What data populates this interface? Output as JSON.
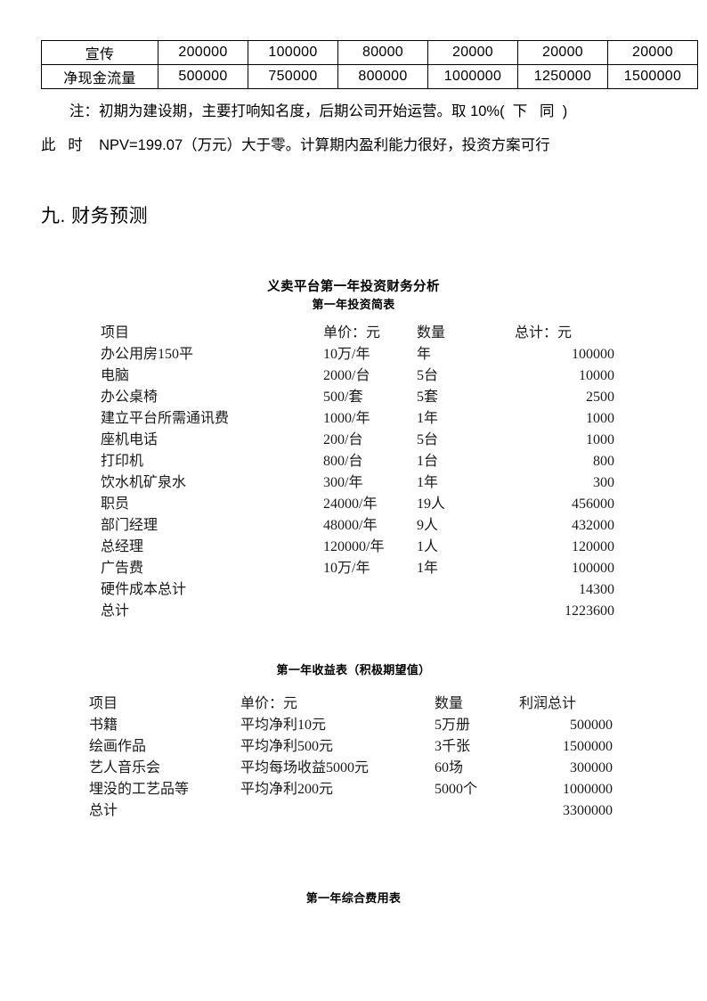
{
  "cashflow_table": {
    "rows": [
      {
        "label": "宣传",
        "values": [
          "200000",
          "100000",
          "80000",
          "20000",
          "20000",
          "20000"
        ]
      },
      {
        "label": "净现金流量",
        "values": [
          "500000",
          "750000",
          "800000",
          "1000000",
          "1250000",
          "1500000"
        ]
      }
    ]
  },
  "notes": {
    "line1": "注：初期为建设期，主要打响知名度，后期公司开始运营。取 10%(  下   同  )",
    "line2": "此   时    NPV=199.07（万元）大于零。计算期内盈利能力很好，投资方案可行"
  },
  "section": {
    "heading": "九. 财务预测"
  },
  "titles": {
    "main": "义卖平台第一年投资财务分析",
    "sub_investment": "第一年投资简表",
    "sub_revenue": "第一年收益表（积极期望值）",
    "sub_expense": "第一年综合费用表"
  },
  "investment_table": {
    "headers": {
      "item": "项目",
      "price": "单价：元",
      "qty": "数量",
      "total": "总计：元"
    },
    "rows": [
      {
        "item": "办公用房150平",
        "price": "10万/年",
        "qty": "年",
        "total": "100000"
      },
      {
        "item": "电脑",
        "price": "2000/台",
        "qty": "5台",
        "total": "10000"
      },
      {
        "item": "办公桌椅",
        "price": "500/套",
        "qty": "5套",
        "total": "2500"
      },
      {
        "item": "建立平台所需通讯费",
        "price": "1000/年",
        "qty": "1年",
        "total": "1000"
      },
      {
        "item": "座机电话",
        "price": "200/台",
        "qty": "5台",
        "total": "1000"
      },
      {
        "item": "打印机",
        "price": "800/台",
        "qty": "1台",
        "total": "800"
      },
      {
        "item": "饮水机矿泉水",
        "price": "300/年",
        "qty": "1年",
        "total": "300"
      },
      {
        "item": "职员",
        "price": "24000/年",
        "qty": "19人",
        "total": "456000"
      },
      {
        "item": "部门经理",
        "price": "48000/年",
        "qty": "9人",
        "total": "432000"
      },
      {
        "item": "总经理",
        "price": "120000/年",
        "qty": "1人",
        "total": "120000"
      },
      {
        "item": "广告费",
        "price": "10万/年",
        "qty": "1年",
        "total": "100000"
      },
      {
        "item": "硬件成本总计",
        "price": "",
        "qty": "",
        "total": "14300"
      },
      {
        "item": "总计",
        "price": "",
        "qty": "",
        "total": "1223600"
      }
    ]
  },
  "revenue_table": {
    "headers": {
      "item": "项目",
      "price": "单价：元",
      "qty": "数量",
      "total": "利润总计"
    },
    "rows": [
      {
        "item": "书籍",
        "price": "平均净利10元",
        "qty": "5万册",
        "total": "500000"
      },
      {
        "item": "绘画作品",
        "price": "平均净利500元",
        "qty": "3千张",
        "total": "1500000"
      },
      {
        "item": "艺人音乐会",
        "price": "平均每场收益5000元",
        "qty": "60场",
        "total": "300000"
      },
      {
        "item": "埋没的工艺品等",
        "price": "平均净利200元",
        "qty": "5000个",
        "total": "1000000"
      },
      {
        "item": "总计",
        "price": "",
        "qty": "",
        "total": "3300000"
      }
    ]
  }
}
